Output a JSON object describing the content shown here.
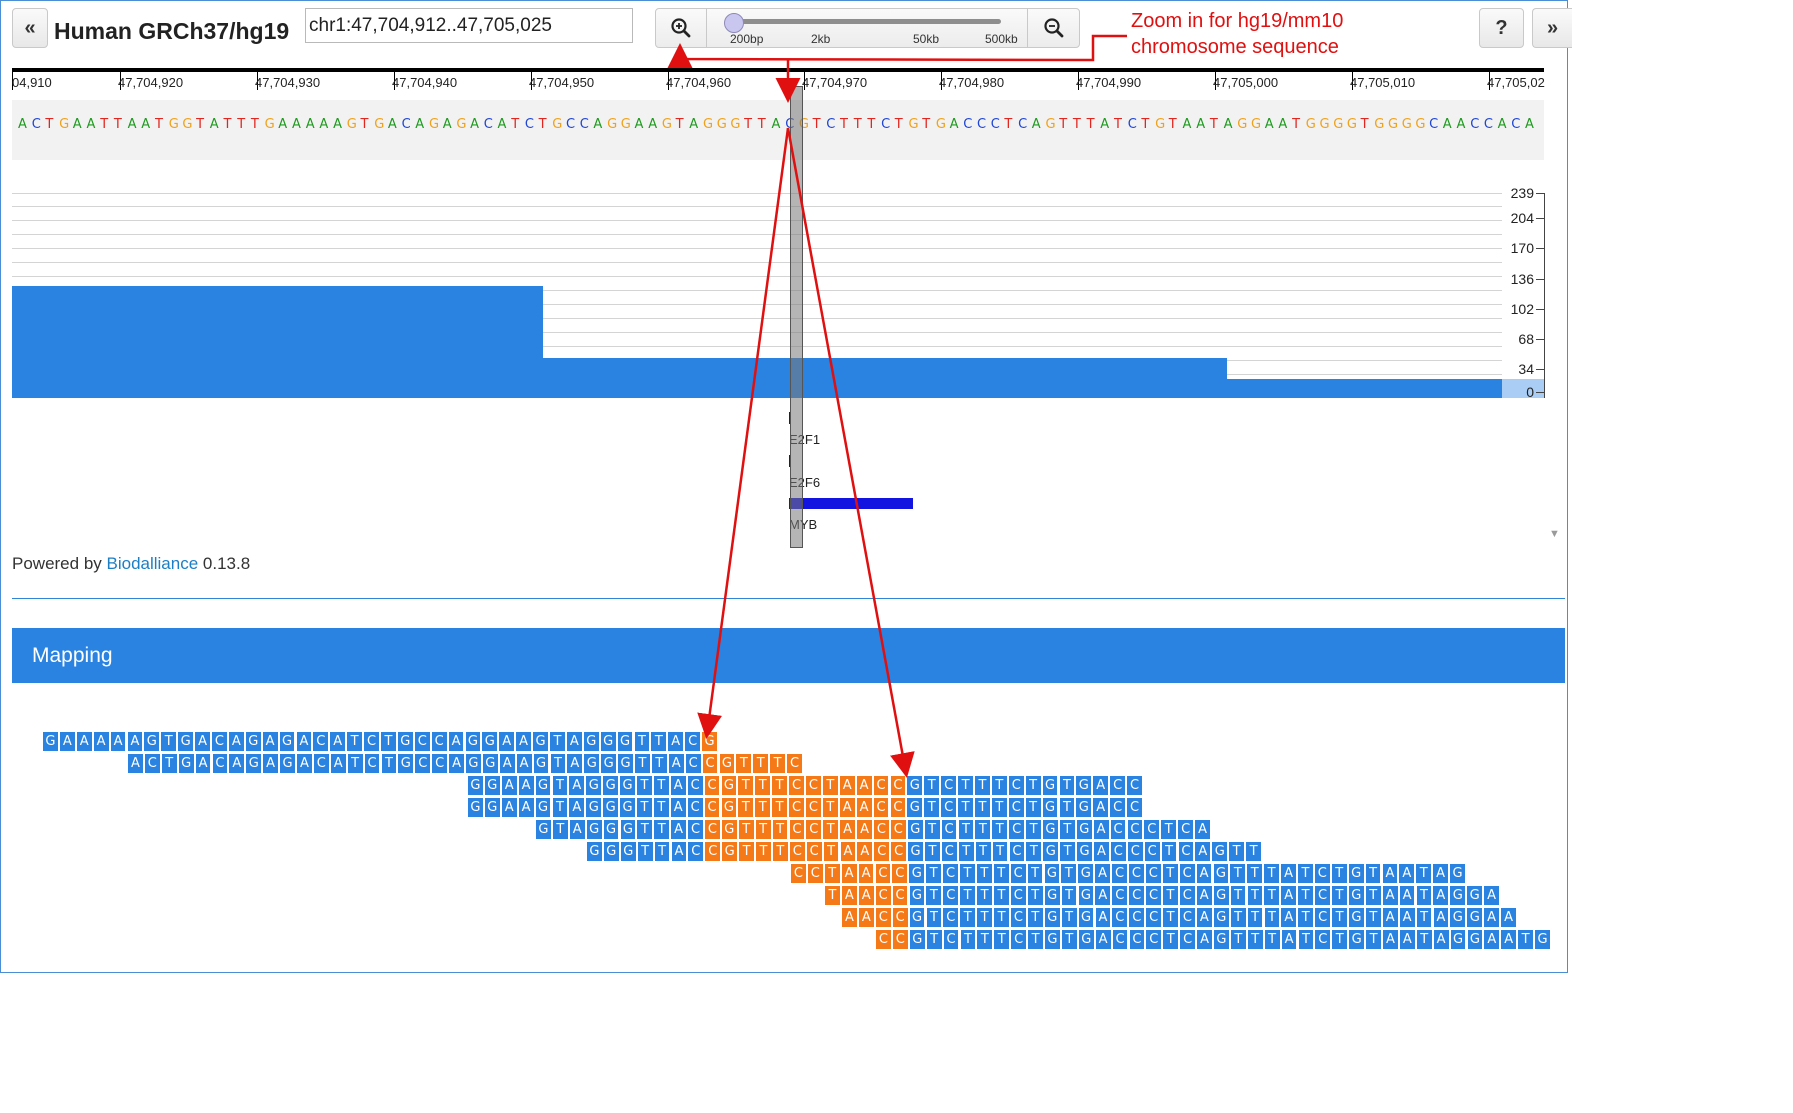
{
  "toolbar": {
    "back_label": "«",
    "genome_title": "Human GRCh37/hg19",
    "location_value": "chr1:47,704,912..47,705,025",
    "zoom_in_icon": "zoom-in-icon",
    "zoom_out_icon": "zoom-out-icon",
    "zoom_ticks": [
      "200bp",
      "2kb",
      "50kb",
      "500kb"
    ],
    "zoom_level_fraction": 0.0,
    "help_label": "?",
    "forward_label": "»"
  },
  "annotation": {
    "line1": "Zoom in for hg19/mm10",
    "line2": "chromosome sequence",
    "color": "#e01010"
  },
  "ruler": {
    "labels": [
      "04,910",
      "47,704,920",
      "47,704,930",
      "47,704,940",
      "47,704,950",
      "47,704,960",
      "47,704,970",
      "47,704,980",
      "47,704,990",
      "47,705,000",
      "47,705,010",
      "47,705,02"
    ]
  },
  "sequence": "ACTGAATTAATGGTATTTGAAAAAGTGACAGAGACATCTGCCAGGAAGTAGGGTTACGTCTTTCTGTGACCCTCAGTTTATCTGTAATAGGAATGGGGTGGGGCAACCACAG",
  "base_colors": {
    "A": "#1e9a1e",
    "C": "#1f46d6",
    "G": "#f0a21a",
    "T": "#e0261e"
  },
  "coverage": {
    "axis_labels": [
      "239",
      "204",
      "170",
      "136",
      "102",
      "68",
      "34",
      "0"
    ],
    "color": "#2a83e0"
  },
  "features": [
    {
      "label": "E2F1"
    },
    {
      "label": "E2F6"
    },
    {
      "label": "MYB"
    }
  ],
  "footer": {
    "powered_prefix": "Powered by ",
    "powered_link": "Biodalliance",
    "powered_version": " 0.13.8"
  },
  "mapping": {
    "title": "Mapping",
    "reads": [
      {
        "seq": "GAAAAAGTGACAGAGACATCTGCCAGGAAGTAGGGTTACG",
        "orange": [
          [
            39,
            40
          ]
        ]
      },
      {
        "seq": "ACTGACAGAGACATCTGCCAGGAAGTAGGGTTACCGTTTC",
        "orange": [
          [
            34,
            40
          ]
        ]
      },
      {
        "seq": "GGAAGTAGGGTTACCGTTTCCTAACCGTCTTTCTGTGACC",
        "orange": [
          [
            14,
            26
          ]
        ]
      },
      {
        "seq": "GGAAGTAGGGTTACCGTTTCCTAACCGTCTTTCTGTGACC",
        "orange": [
          [
            14,
            26
          ]
        ]
      },
      {
        "seq": "GTAGGGTTACCGTTTCCTAACCGTCTTTCTGTGACCCTCA",
        "orange": [
          [
            10,
            22
          ]
        ]
      },
      {
        "seq": "GGGTTACCGTTTCCTAACCGTCTTTCTGTGACCCTCAGTT",
        "orange": [
          [
            7,
            19
          ]
        ]
      },
      {
        "seq": "CCTAACCGTCTTTCTGTGACCCTCAGTTTATCTGTAATAG",
        "orange": [
          [
            0,
            7
          ]
        ]
      },
      {
        "seq": "TAACCGTCTTTCTGTGACCCTCAGTTTATCTGTAATAGGA",
        "orange": [
          [
            0,
            5
          ]
        ]
      },
      {
        "seq": "AACCGTCTTTCTGTGACCCTCAGTTTATCTGTAATAGGAA",
        "orange": [
          [
            0,
            4
          ]
        ]
      },
      {
        "seq": "CCGTCTTTCTGTGACCCTCAGTTTATCTGTAATAGGAATG",
        "orange": [
          [
            0,
            2
          ]
        ]
      }
    ]
  }
}
